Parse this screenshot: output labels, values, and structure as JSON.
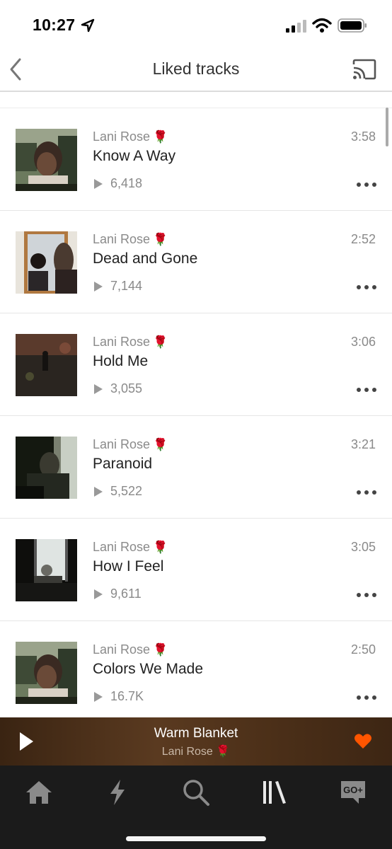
{
  "status_bar": {
    "time": "10:27"
  },
  "header": {
    "title": "Liked tracks"
  },
  "tracks": [
    {
      "artist": "Lani Rose",
      "artist_emoji": "🌹",
      "title": "Know A Way",
      "plays": "6,418",
      "duration": "3:58"
    },
    {
      "artist": "Lani Rose",
      "artist_emoji": "🌹",
      "title": "Dead and Gone",
      "plays": "7,144",
      "duration": "2:52"
    },
    {
      "artist": "Lani Rose",
      "artist_emoji": "🌹",
      "title": "Hold Me",
      "plays": "3,055",
      "duration": "3:06"
    },
    {
      "artist": "Lani Rose",
      "artist_emoji": "🌹",
      "title": "Paranoid",
      "plays": "5,522",
      "duration": "3:21"
    },
    {
      "artist": "Lani Rose",
      "artist_emoji": "🌹",
      "title": "How I Feel",
      "plays": "9,611",
      "duration": "3:05"
    },
    {
      "artist": "Lani Rose",
      "artist_emoji": "🌹",
      "title": "Colors We Made",
      "plays": "16.7K",
      "duration": "2:50"
    }
  ],
  "now_playing": {
    "title": "Warm Blanket",
    "artist": "Lani Rose",
    "artist_emoji": "🌹",
    "liked": true
  },
  "tab_bar": {
    "tabs": [
      {
        "name": "home",
        "icon": "home-icon",
        "active": false
      },
      {
        "name": "stream",
        "icon": "lightning-icon",
        "active": false
      },
      {
        "name": "search",
        "icon": "search-icon",
        "active": false
      },
      {
        "name": "library",
        "icon": "library-icon",
        "active": true
      },
      {
        "name": "go-plus",
        "icon": "go-plus-icon",
        "label": "GO+",
        "active": false
      }
    ]
  },
  "colors": {
    "accent": "#ff5500",
    "tab_bar_bg": "#1b1b1b",
    "player_bg": "#4b2f18"
  }
}
